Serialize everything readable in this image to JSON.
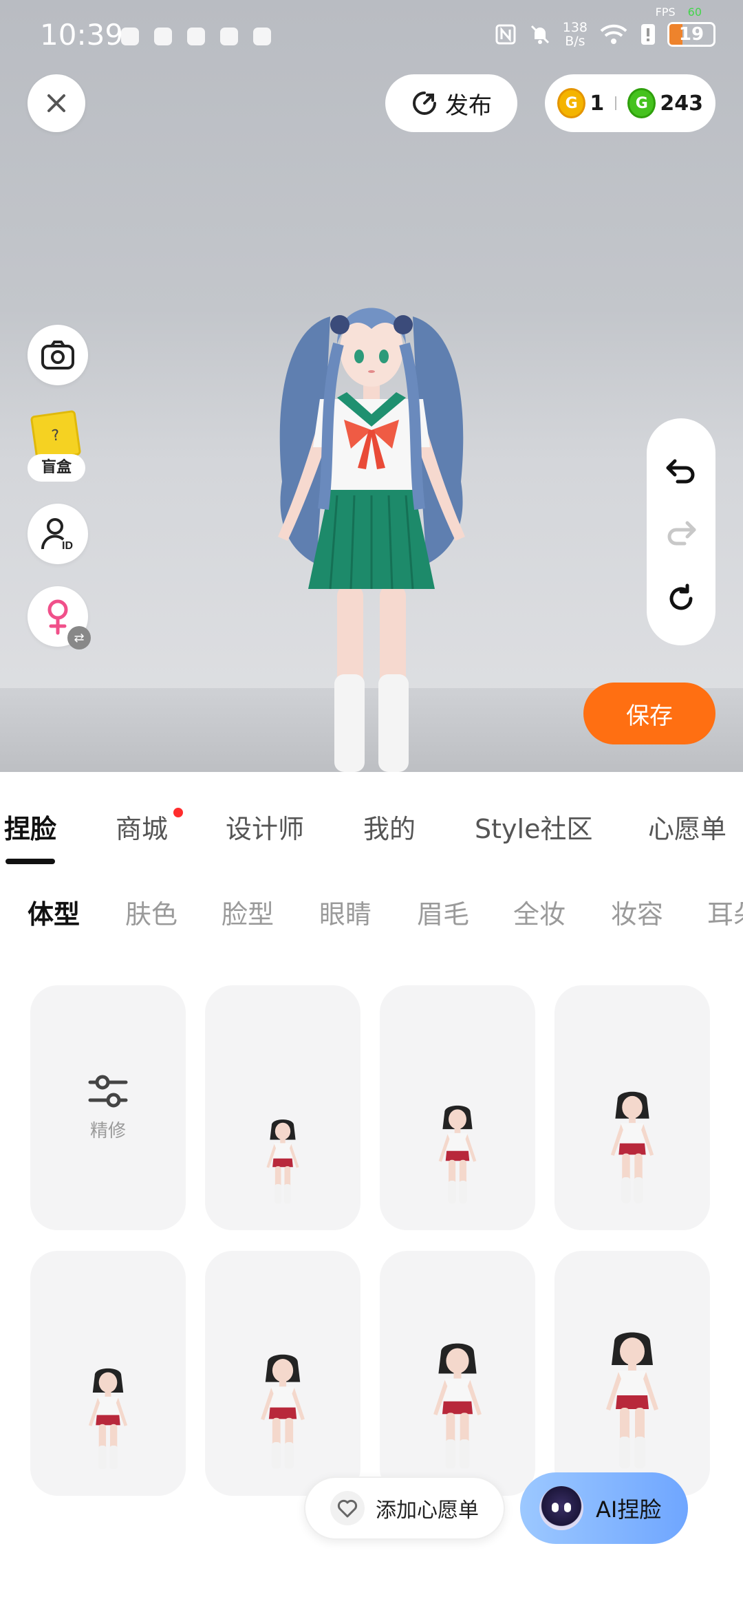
{
  "status_bar": {
    "time": "10:39",
    "network_speed_top": "138",
    "network_speed_bottom": "B/s",
    "battery": "19",
    "fps_label": "FPS",
    "fps_value": "60"
  },
  "top_bar": {
    "publish_label": "发布",
    "coin_gold_count": "1",
    "coin_green_count": "243",
    "coin_gold_symbol": "G",
    "coin_green_symbol": "G"
  },
  "left_tools": {
    "blindbox_label": "盲盒",
    "blindbox_mark": "?",
    "id_mark": "ID"
  },
  "save_label": "保存",
  "main_tabs": [
    {
      "label": "捏脸",
      "active": true
    },
    {
      "label": "商城",
      "active": false,
      "badge": true
    },
    {
      "label": "设计师",
      "active": false
    },
    {
      "label": "我的",
      "active": false
    },
    {
      "label": "Style社区",
      "active": false
    },
    {
      "label": "心愿单",
      "active": false
    }
  ],
  "sub_tabs": [
    {
      "label": "体型",
      "active": true
    },
    {
      "label": "肤色",
      "active": false
    },
    {
      "label": "脸型",
      "active": false
    },
    {
      "label": "眼睛",
      "active": false
    },
    {
      "label": "眉毛",
      "active": false
    },
    {
      "label": "全妆",
      "active": false
    },
    {
      "label": "妆容",
      "active": false
    },
    {
      "label": "耳朵",
      "active": false
    }
  ],
  "grid": {
    "refine_label": "精修"
  },
  "bottom_actions": {
    "wishlist_label": "添加心愿单",
    "ai_label": "AI捏脸"
  },
  "colors": {
    "accent_orange": "#ff6f12",
    "coin_gold": "#f4b400",
    "coin_green": "#45c21e",
    "badge_red": "#ff2d2d",
    "ai_button": "#7fb0ff"
  },
  "icons": [
    "close-icon",
    "publish-icon",
    "camera-icon",
    "blindbox-icon",
    "avatar-id-icon",
    "female-icon",
    "swap-icon",
    "undo-icon",
    "redo-icon",
    "reset-icon",
    "sliders-icon",
    "heart-icon",
    "ai-avatar-icon"
  ]
}
